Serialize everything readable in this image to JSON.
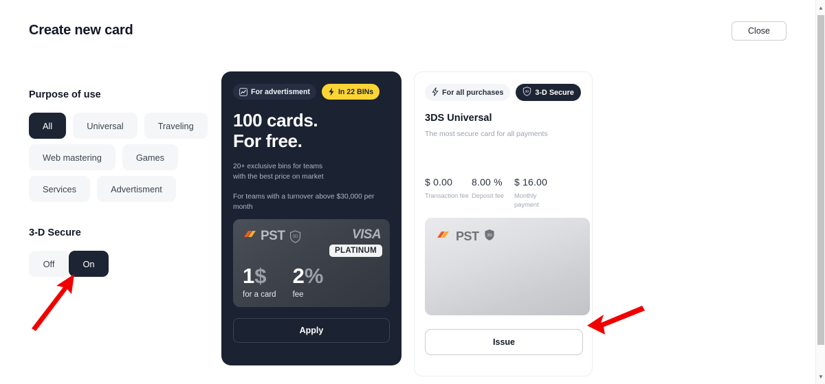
{
  "header": {
    "title": "Create new card",
    "close_label": "Close"
  },
  "left": {
    "purpose_title": "Purpose of use",
    "purpose_options": [
      {
        "label": "All",
        "active": true
      },
      {
        "label": "Universal",
        "active": false
      },
      {
        "label": "Traveling",
        "active": false
      },
      {
        "label": "Web mastering",
        "active": false
      },
      {
        "label": "Games",
        "active": false
      },
      {
        "label": "Services",
        "active": false
      },
      {
        "label": "Advertisment",
        "active": false
      }
    ],
    "secure_title": "3-D Secure",
    "secure_off": "Off",
    "secure_on": "On",
    "secure_selected": "On"
  },
  "promo": {
    "badge_advertisement": "For advertisment",
    "badge_bins": "In 22 BINs",
    "headline_line1": "100 cards.",
    "headline_line2": "For free.",
    "sub_line1": "20+ exclusive bins for teams",
    "sub_line2": "with the best price on market",
    "sub2_line1": "For teams with a turnover above $30,000 per",
    "sub2_line2": "month",
    "card": {
      "brand": "PST",
      "secure_badge": "3D",
      "network": "VISA",
      "tier": "PLATINUM",
      "price_1_value": "1",
      "price_1_unit": "$",
      "price_1_label": "for a card",
      "price_2_value": "2",
      "price_2_unit": "%",
      "price_2_label": "fee"
    },
    "apply_label": "Apply"
  },
  "right": {
    "tab_all_purchases": "For all purchases",
    "tab_3d_secure": "3-D Secure",
    "tab_selected": "3-D Secure",
    "title": "3DS Universal",
    "description": "The most secure card for all payments",
    "fees": [
      {
        "value": "$ 0.00",
        "label": "Transaction fee"
      },
      {
        "value": "8.00 %",
        "label": "Deposit fee"
      },
      {
        "value": "$ 16.00",
        "label": "Monthly payment"
      }
    ],
    "card": {
      "brand": "PST",
      "secure_badge": "3D"
    },
    "issue_label": "Issue"
  },
  "colors": {
    "dark": "#1d2433",
    "yellow": "#fcd535",
    "arrow_red": "#f20000",
    "panel_bg": "#ffffff"
  }
}
